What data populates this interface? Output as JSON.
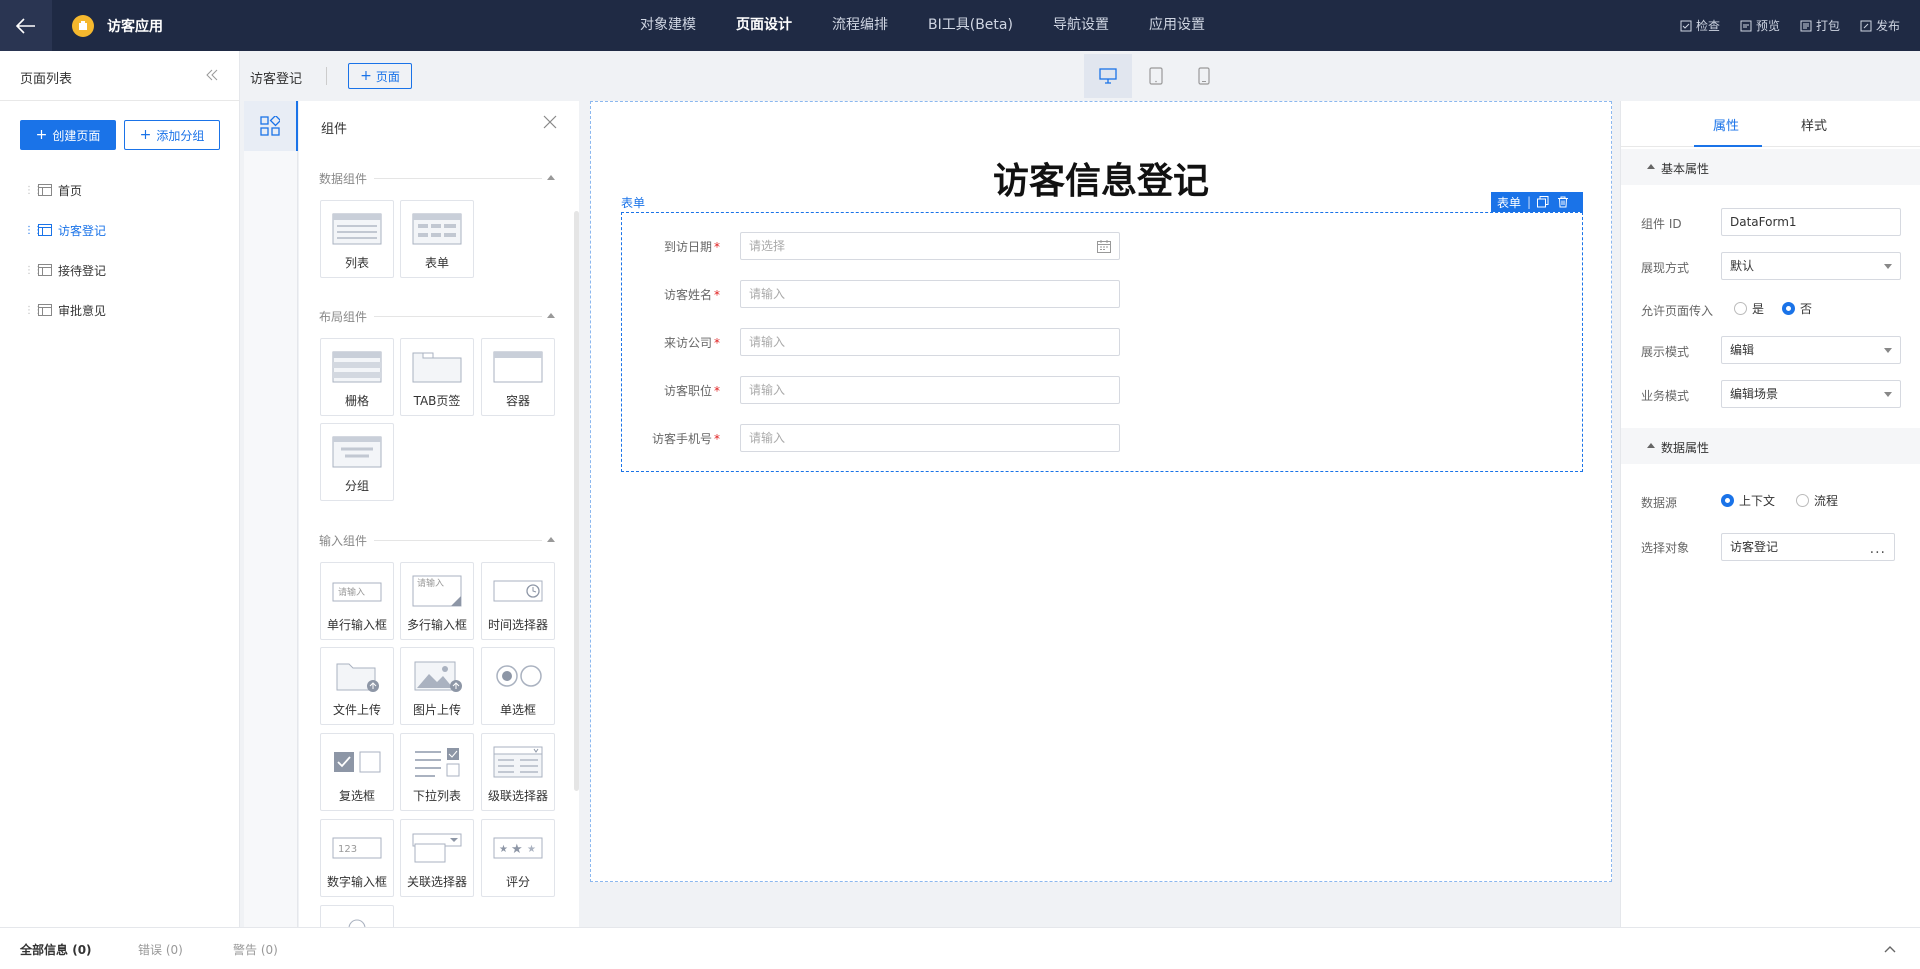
{
  "app": {
    "name": "访客应用",
    "nav": [
      "对象建模",
      "页面设计",
      "流程编排",
      "BI工具(Beta)",
      "导航设置",
      "应用设置"
    ],
    "nav_active": 1,
    "actions": [
      "检查",
      "预览",
      "打包",
      "发布"
    ]
  },
  "page_list": {
    "title": "页面列表",
    "create_button": "创建页面",
    "add_group_button": "添加分组",
    "items": [
      "首页",
      "访客登记",
      "接待登记",
      "审批意见"
    ],
    "active_index": 1
  },
  "editor": {
    "current_page": "访客登记",
    "add_page_button": "页面"
  },
  "palette": {
    "title": "组件",
    "sections": [
      {
        "title": "数据组件",
        "items": [
          "列表",
          "表单"
        ]
      },
      {
        "title": "布局组件",
        "items": [
          "栅格",
          "TAB页签",
          "容器",
          "分组"
        ]
      },
      {
        "title": "输入组件",
        "items": [
          "单行输入框",
          "多行输入框",
          "时间选择器",
          "文件上传",
          "图片上传",
          "单选框",
          "复选框",
          "下拉列表",
          "级联选择器",
          "数字输入框",
          "关联选择器",
          "评分"
        ]
      }
    ],
    "icon_text": {
      "single_input": "请输入",
      "multi_input": "请输入",
      "number_input": "123"
    }
  },
  "canvas": {
    "title": "访客信息登记",
    "form_tag": "表单",
    "form_tools_label": "表单",
    "fields": [
      {
        "label": "到访日期",
        "placeholder": "请选择",
        "required": "*"
      },
      {
        "label": "访客姓名",
        "placeholder": "请输入",
        "required": "*"
      },
      {
        "label": "来访公司",
        "placeholder": "请输入",
        "required": "*"
      },
      {
        "label": "访客职位",
        "placeholder": "请输入",
        "required": "*"
      },
      {
        "label": "访客手机号",
        "placeholder": "请输入",
        "required": "*"
      }
    ]
  },
  "props": {
    "tabs": [
      "属性",
      "样式"
    ],
    "basic_group": "基本属性",
    "component_id_label": "组件 ID",
    "component_id_value": "DataForm1",
    "display_mode_label": "展现方式",
    "display_mode_value": "默认",
    "allow_pass_label": "允许页面传入",
    "allow_pass_yes": "是",
    "allow_pass_no": "否",
    "show_mode_label": "展示模式",
    "show_mode_value": "编辑",
    "biz_mode_label": "业务模式",
    "biz_mode_value": "编辑场景",
    "data_group": "数据属性",
    "datasource_label": "数据源",
    "datasource_context": "上下文",
    "datasource_flow": "流程",
    "object_label": "选择对象",
    "object_value": "访客登记",
    "object_more": "···"
  },
  "bottom": {
    "all": "全部信息",
    "all_count": "(0)",
    "errors": "错误",
    "errors_count": "(0)",
    "warnings": "警告",
    "warnings_count": "(0)"
  },
  "colors": {
    "accent": "#1a73e8",
    "topbar": "#1f2a44",
    "required": "#e02020"
  }
}
